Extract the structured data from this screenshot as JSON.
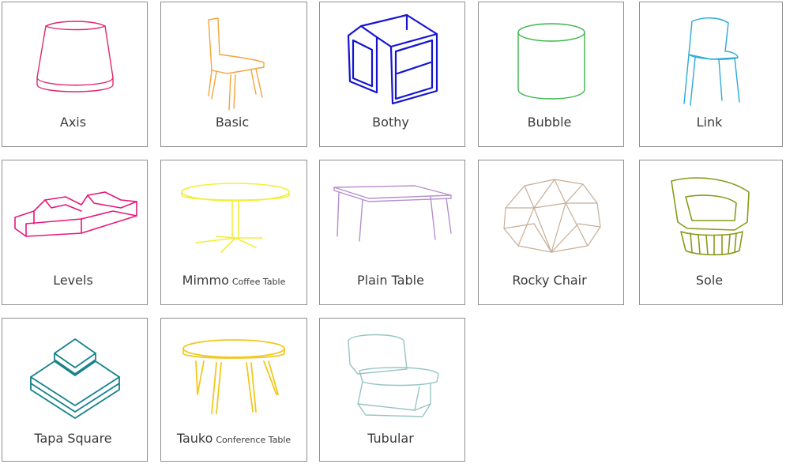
{
  "products": [
    {
      "key": "axis",
      "name": "Axis",
      "subtitle": "",
      "icon": "axis-stool-icon",
      "color": "#e0286e"
    },
    {
      "key": "basic",
      "name": "Basic",
      "subtitle": "",
      "icon": "basic-chair-icon",
      "color": "#f5a43c"
    },
    {
      "key": "bothy",
      "name": "Bothy",
      "subtitle": "",
      "icon": "bothy-booth-icon",
      "color": "#1414d2"
    },
    {
      "key": "bubble",
      "name": "Bubble",
      "subtitle": "",
      "icon": "bubble-pouf-icon",
      "color": "#3cb44b"
    },
    {
      "key": "link",
      "name": "Link",
      "subtitle": "",
      "icon": "link-chair-icon",
      "color": "#2aaad8"
    },
    {
      "key": "levels",
      "name": "Levels",
      "subtitle": "",
      "icon": "levels-seating-icon",
      "color": "#e6187c"
    },
    {
      "key": "mimmo",
      "name": "Mimmo",
      "subtitle": "Coffee Table",
      "icon": "mimmo-table-icon",
      "color": "#f2ef3a"
    },
    {
      "key": "plain",
      "name": "Plain Table",
      "subtitle": "",
      "icon": "plain-table-icon",
      "color": "#b68fd0"
    },
    {
      "key": "rocky",
      "name": "Rocky Chair",
      "subtitle": "",
      "icon": "rocky-chair-icon",
      "color": "#c8ad98"
    },
    {
      "key": "sole",
      "name": "Sole",
      "subtitle": "",
      "icon": "sole-chair-icon",
      "color": "#8a9b1a"
    },
    {
      "key": "tapa",
      "name": "Tapa Square",
      "subtitle": "",
      "icon": "tapa-square-icon",
      "color": "#15828a"
    },
    {
      "key": "tauko",
      "name": "Tauko",
      "subtitle": "Conference Table",
      "icon": "tauko-table-icon",
      "color": "#f2c81e"
    },
    {
      "key": "tubular",
      "name": "Tubular",
      "subtitle": "",
      "icon": "tubular-chair-icon",
      "color": "#98c4c4"
    }
  ]
}
